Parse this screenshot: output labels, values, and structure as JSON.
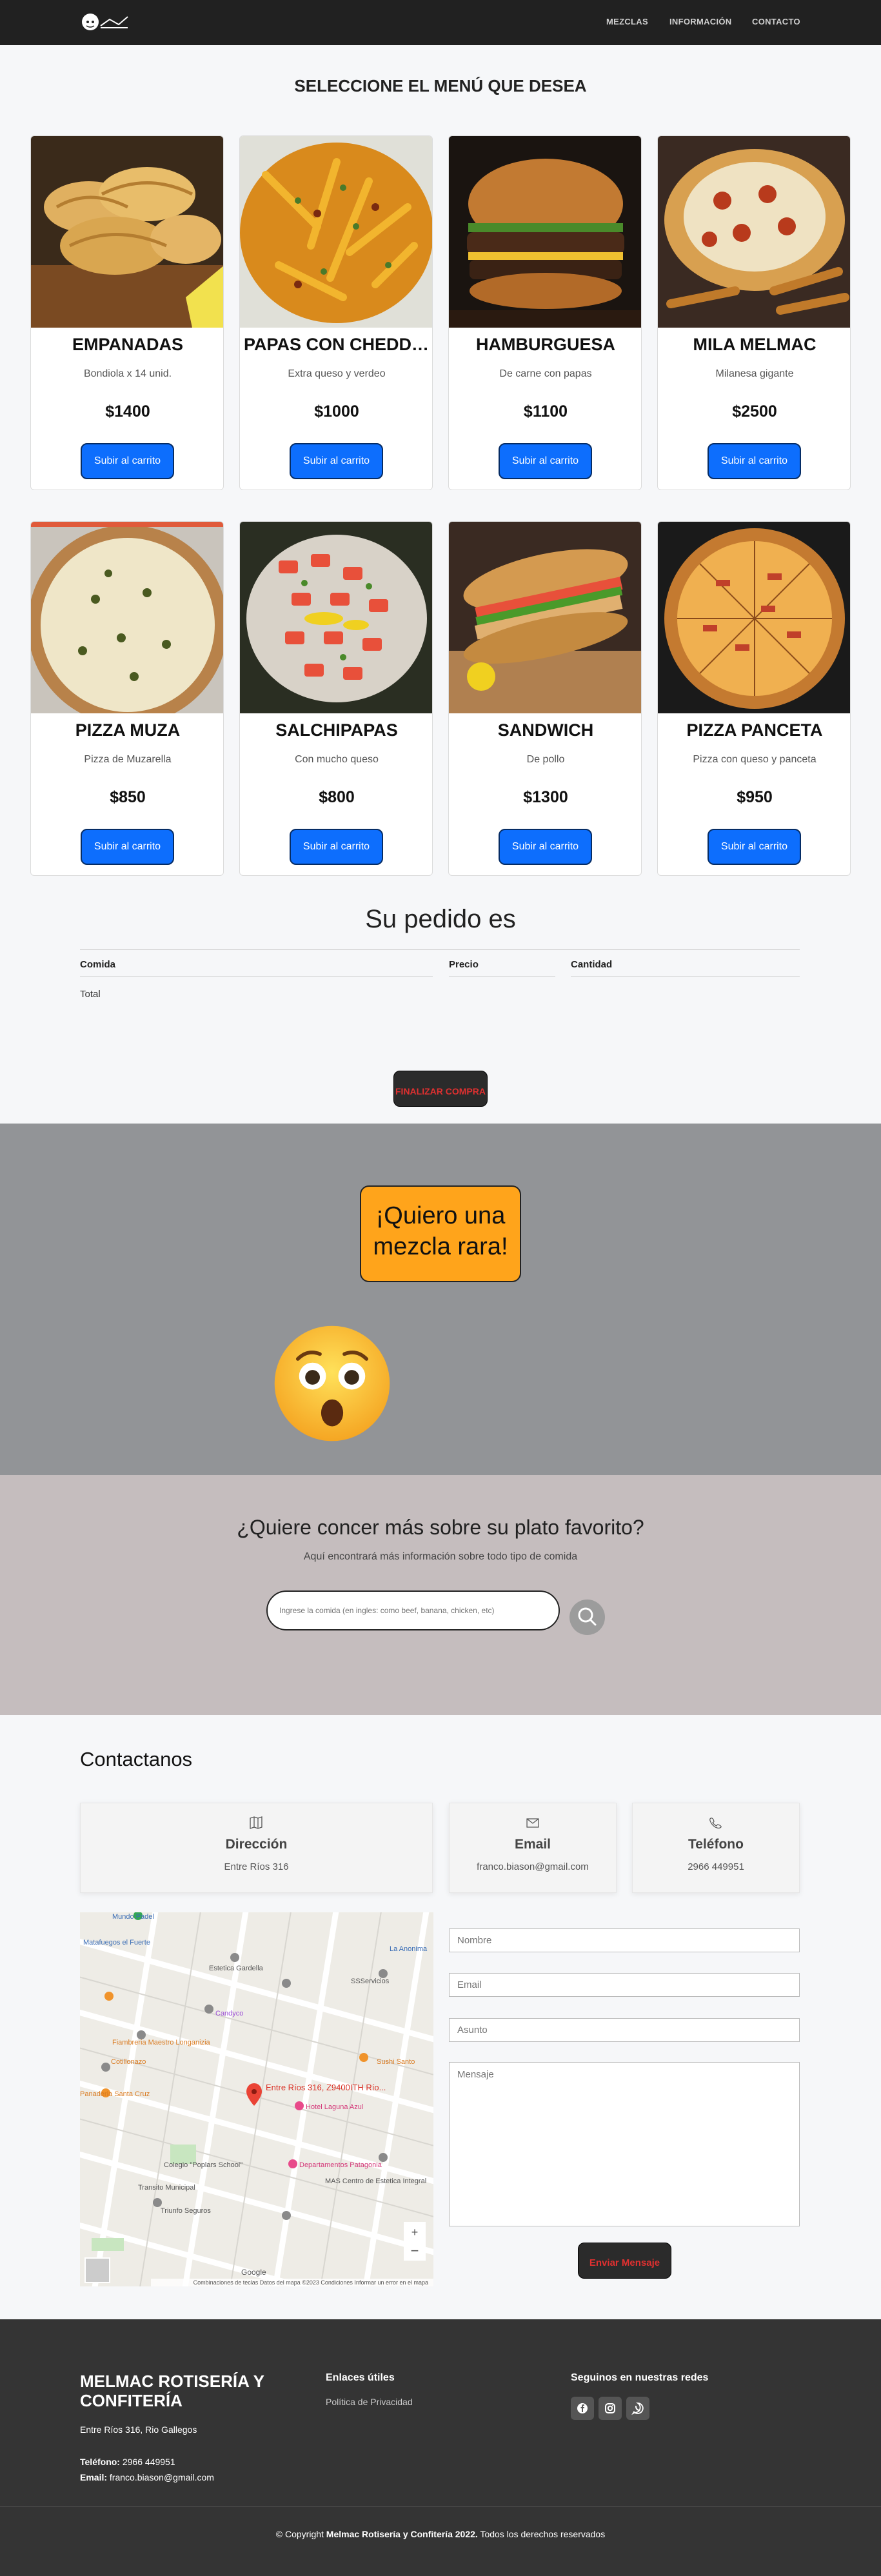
{
  "header": {
    "nav": [
      "MEZCLAS",
      "INFORMACIÓN",
      "CONTACTO"
    ]
  },
  "menu": {
    "title": "SELECCIONE EL MENÚ QUE DESEA",
    "button_label": "Subir al carrito",
    "items": [
      {
        "name": "EMPANADAS",
        "desc": "Bondiola x 14 unid.",
        "price": "$1400"
      },
      {
        "name": "PAPAS CON CHEDDAR",
        "desc": "Extra queso y verdeo",
        "price": "$1000"
      },
      {
        "name": "HAMBURGUESA",
        "desc": "De carne con papas",
        "price": "$1100"
      },
      {
        "name": "MILA MELMAC",
        "desc": "Milanesa gigante",
        "price": "$2500"
      },
      {
        "name": "PIZZA MUZA",
        "desc": "Pizza de Muzarella",
        "price": "$850"
      },
      {
        "name": "SALCHIPAPAS",
        "desc": "Con mucho queso",
        "price": "$800"
      },
      {
        "name": "SANDWICH",
        "desc": "De pollo",
        "price": "$1300"
      },
      {
        "name": "PIZZA PANCETA",
        "desc": "Pizza con queso y panceta",
        "price": "$950"
      }
    ]
  },
  "order": {
    "title": "Su pedido es",
    "col_comida": "Comida",
    "col_precio": "Precio",
    "col_cantidad": "Cantidad",
    "total_label": "Total",
    "finalizar": "FINALIZAR COMPRA"
  },
  "promo": {
    "mezcla_rara": "¡Quiero una mezcla rara!"
  },
  "search": {
    "title": "¿Quiere concer más sobre su plato favorito?",
    "subtitle": "Aquí encontrará más información sobre todo tipo de comida",
    "placeholder": "Ingrese la comida (en ingles: como beef, banana, chicken, etc)"
  },
  "contact": {
    "title": "Contactanos",
    "boxes": [
      {
        "title": "Dirección",
        "value": "Entre Ríos 316",
        "icon": "map-icon"
      },
      {
        "title": "Email",
        "value": "franco.biason@gmail.com",
        "icon": "envelope-icon"
      },
      {
        "title": "Teléfono",
        "value": "2966 449951",
        "icon": "phone-icon"
      }
    ],
    "map_pin_label": "Entre Ríos 316, Z9400ITH Río...",
    "map_labels": [
      "Mundo Padel",
      "Matafuegos el Fuerte",
      "La Anonima",
      "Estetica Gardella",
      "SSServicios",
      "Candyco",
      "Fiambreria Maestro Longanizia",
      "Cotillonazo",
      "Panaderia Santa Cruz",
      "Hotel Laguna Azul",
      "Departamentos Patagonia",
      "Colegio \"Poplars School\"",
      "Transito Municipal",
      "MAS Centro de Estetica Integral",
      "Triunfo Seguros",
      "Sushi Santo",
      "Google"
    ],
    "map_footer": "Combinaciones de teclas   Datos del mapa ©2023   Condiciones   Informar un error en el mapa",
    "placeholders": {
      "nombre": "Nombre",
      "email": "Email",
      "asunto": "Asunto",
      "mensaje": "Mensaje"
    },
    "send": "Enviar Mensaje"
  },
  "footer": {
    "brand": "MELMAC ROTISERÍA Y CONFITERÍA",
    "address": "Entre Ríos 316, Rio Gallegos",
    "phone_label": "Teléfono:",
    "phone": "2966 449951",
    "email_label": "Email:",
    "email": "franco.biason@gmail.com",
    "links_title": "Enlaces útiles",
    "link_privacy": "Política de Privacidad",
    "social_title": "Seguinos en nuestras redes",
    "social_icons": [
      "facebook-icon",
      "instagram-icon",
      "whatsapp-icon"
    ],
    "copy_prefix": "© Copyright",
    "copy_brand": "Melmac Rotisería y Confitería 2022.",
    "copy_suffix": "Todos los derechos reservados"
  },
  "colors": {
    "header_bg": "#212121",
    "button_blue": "#0d6efd",
    "grey_block": "#929497",
    "promo_orange": "#ffa41b",
    "search_bg": "#c5bdbe",
    "footer_bg": "#343434",
    "accent_red": "#e03030"
  }
}
